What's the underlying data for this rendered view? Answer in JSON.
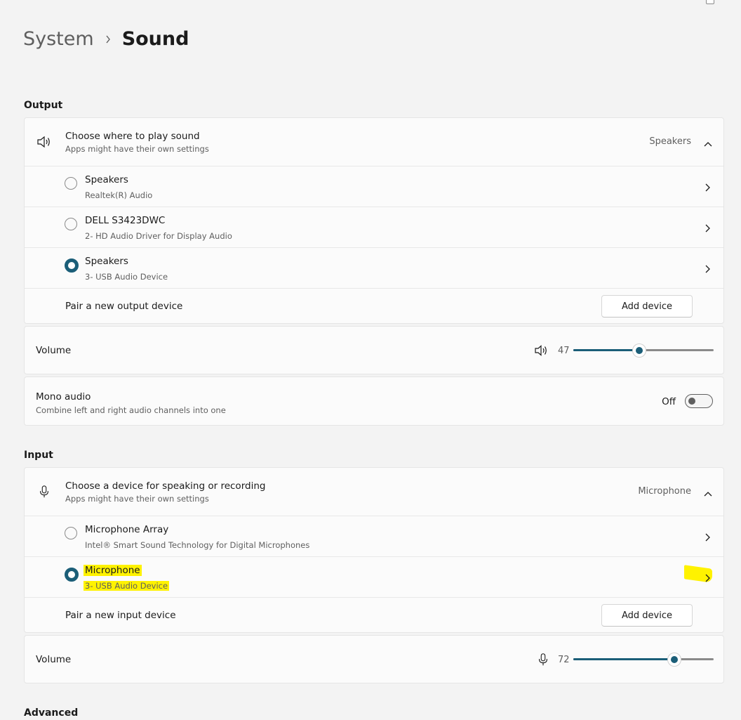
{
  "breadcrumb": {
    "parent": "System",
    "current": "Sound"
  },
  "output": {
    "section_label": "Output",
    "header": {
      "title": "Choose where to play sound",
      "subtitle": "Apps might have their own settings",
      "selected_value": "Speakers",
      "icon": "speaker-icon"
    },
    "devices": [
      {
        "name": "Speakers",
        "detail": "Realtek(R) Audio",
        "selected": false
      },
      {
        "name": "DELL S3423DWC",
        "detail": "2- HD Audio Driver for Display Audio",
        "selected": false
      },
      {
        "name": "Speakers",
        "detail": "3- USB Audio Device",
        "selected": true
      }
    ],
    "pair": {
      "label": "Pair a new output device",
      "button": "Add device"
    },
    "volume": {
      "label": "Volume",
      "value": "47",
      "level_percent": 47,
      "icon": "speaker-icon"
    },
    "mono": {
      "title": "Mono audio",
      "subtitle": "Combine left and right audio channels into one",
      "state": "Off"
    }
  },
  "input": {
    "section_label": "Input",
    "header": {
      "title": "Choose a device for speaking or recording",
      "subtitle": "Apps might have their own settings",
      "selected_value": "Microphone",
      "icon": "microphone-icon"
    },
    "devices": [
      {
        "name": "Microphone Array",
        "detail": "Intel® Smart Sound Technology for Digital Microphones",
        "selected": false
      },
      {
        "name": "Microphone",
        "detail": "3- USB Audio Device",
        "selected": true,
        "highlighted": true
      }
    ],
    "pair": {
      "label": "Pair a new input device",
      "button": "Add device"
    },
    "volume": {
      "label": "Volume",
      "value": "72",
      "level_percent": 72,
      "icon": "microphone-icon"
    }
  },
  "advanced": {
    "section_label": "Advanced"
  },
  "colors": {
    "accent": "#1b5e78",
    "highlight": "#fff200",
    "background": "#f3f3f3",
    "card": "#fbfbfb"
  }
}
